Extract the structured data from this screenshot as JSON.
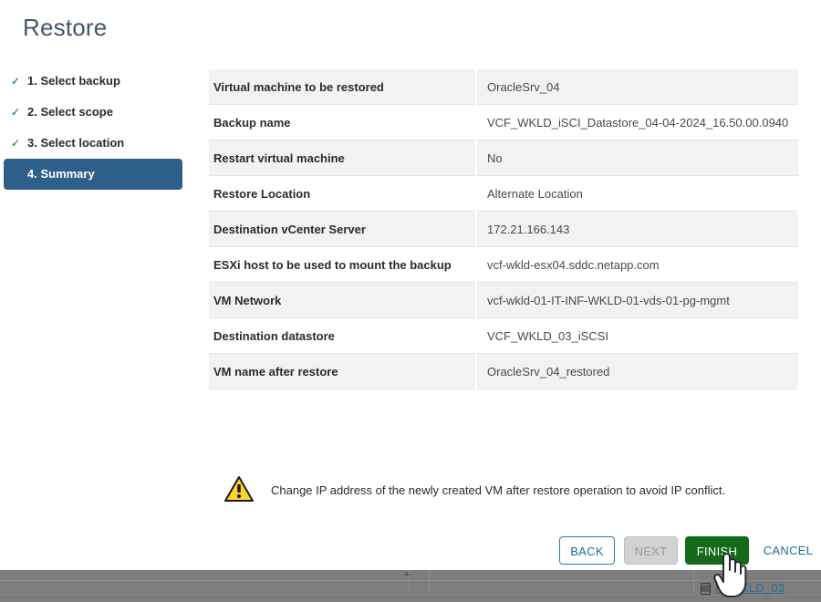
{
  "wizard": {
    "title": "Restore",
    "steps": [
      {
        "label": "1. Select backup",
        "state": "done",
        "check": "✓"
      },
      {
        "label": "2. Select scope",
        "state": "done",
        "check": "✓"
      },
      {
        "label": "3. Select location",
        "state": "done",
        "check": "✓"
      },
      {
        "label": "4. Summary",
        "state": "active",
        "check": ""
      }
    ],
    "summary_rows": [
      {
        "key": "Virtual machine to be restored",
        "value": "OracleSrv_04"
      },
      {
        "key": "Backup name",
        "value": "VCF_WKLD_iSCI_Datastore_04-04-2024_16.50.00.0940"
      },
      {
        "key": "Restart virtual machine",
        "value": "No"
      },
      {
        "key": "Restore Location",
        "value": "Alternate Location"
      },
      {
        "key": "Destination vCenter Server",
        "value": "172.21.166.143"
      },
      {
        "key": "ESXi host to be used to mount the backup",
        "value": "vcf-wkld-esx04.sddc.netapp.com"
      },
      {
        "key": "VM Network",
        "value": "vcf-wkld-01-IT-INF-WKLD-01-vds-01-pg-mgmt"
      },
      {
        "key": "Destination datastore",
        "value": "VCF_WKLD_03_iSCSI"
      },
      {
        "key": "VM name after restore",
        "value": "OracleSrv_04_restored"
      }
    ],
    "warning": {
      "icon": "warning-triangle-icon",
      "text": "Change IP address of the newly created VM after restore operation to avoid IP conflict."
    },
    "buttons": {
      "back": "BACK",
      "next": "NEXT",
      "finish": "FINISH",
      "cancel": "CANCEL"
    }
  },
  "background": {
    "datastore_link": "F_WKLD_03",
    "datastore_icon": "datastore-icon"
  },
  "cursor": {
    "icon": "hand-pointer-cursor"
  },
  "colors": {
    "title": "#455668",
    "step_active_bg": "#2e5f8a",
    "check_green": "#34a853",
    "finish_green": "#14691b",
    "link_blue": "#1f6d99",
    "row_alt_bg": "#f2f2f2",
    "warning_yellow": "#ffd42a",
    "backdrop_gray": "#7d7d7d"
  }
}
